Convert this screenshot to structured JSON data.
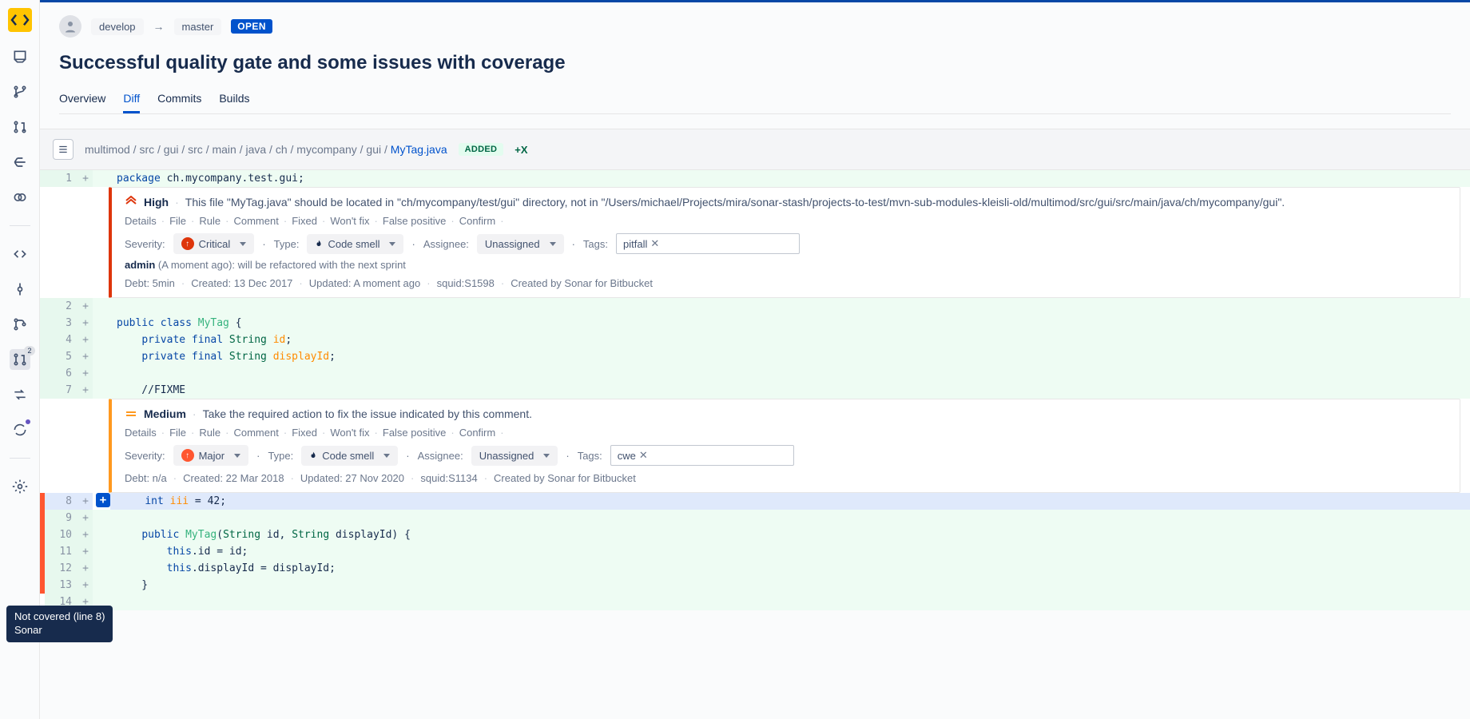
{
  "branch": {
    "from": "develop",
    "to": "master",
    "status": "OPEN"
  },
  "title": "Successful quality gate and some issues with coverage",
  "tabs": [
    "Overview",
    "Diff",
    "Commits",
    "Builds"
  ],
  "active_tab": "Diff",
  "file": {
    "path_prefix": "multimod / src / gui / src / main / java / ch / mycompany / gui / ",
    "filename": "MyTag.java",
    "badge": "ADDED",
    "plus": "+X"
  },
  "lines": {
    "l1": {
      "n": "1",
      "code_html": "<span class='kw'>package</span> ch.mycompany.test.gui;"
    },
    "l2": {
      "n": "2",
      "code_html": ""
    },
    "l3": {
      "n": "3",
      "code_html": "<span class='kw'>public class</span> <span class='cls'>MyTag</span> {"
    },
    "l4": {
      "n": "4",
      "code_html": "    <span class='kw'>private final</span> <span class='typ'>String</span> <span class='id-col'>id</span>;"
    },
    "l5": {
      "n": "5",
      "code_html": "    <span class='kw'>private final</span> <span class='typ'>String</span> <span class='id-col'>displayId</span>;"
    },
    "l6": {
      "n": "6",
      "code_html": ""
    },
    "l7": {
      "n": "7",
      "code_html": "    //FIXME"
    },
    "l8": {
      "n": "8",
      "code_html": "    <span class='kw'>int</span> <span class='id-col'>iii</span> = 42;"
    },
    "l9": {
      "n": "9",
      "code_html": ""
    },
    "l10": {
      "n": "10",
      "code_html": "    <span class='kw'>public</span> <span class='cls'>MyTag</span>(<span class='typ'>String</span> id, <span class='typ'>String</span> displayId) {"
    },
    "l11": {
      "n": "11",
      "code_html": "        <span class='kw'>this</span>.id = id;"
    },
    "l12": {
      "n": "12",
      "code_html": "        <span class='kw'>this</span>.displayId = displayId;"
    },
    "l13": {
      "n": "13",
      "code_html": "    }"
    },
    "l14": {
      "n": "14",
      "code_html": ""
    }
  },
  "issue1": {
    "severity_label": "High",
    "message": "This file \"MyTag.java\" should be located in \"ch/mycompany/test/gui\" directory, not in \"/Users/michael/Projects/mira/sonar-stash/projects-to-test/mvn-sub-modules-kleisli-old/multimod/src/gui/src/main/java/ch/mycompany/gui\".",
    "actions": [
      "Details",
      "File",
      "Rule",
      "Comment",
      "Fixed",
      "Won't fix",
      "False positive",
      "Confirm"
    ],
    "severity_label2": "Severity:",
    "severity_dd": "Critical",
    "type_label": "Type:",
    "type_dd": "Code smell",
    "assignee_label": "Assignee:",
    "assignee_dd": "Unassigned",
    "tags_label": "Tags:",
    "tag": "pitfall",
    "comment_who": "admin",
    "comment_when": "(A moment ago):",
    "comment_text": "will be refactored with the next sprint",
    "meta": [
      "Debt: 5min",
      "Created: 13 Dec 2017",
      "Updated: A moment ago",
      "squid:S1598",
      "Created by Sonar for Bitbucket"
    ]
  },
  "issue2": {
    "severity_label": "Medium",
    "message": "Take the required action to fix the issue indicated by this comment.",
    "actions": [
      "Details",
      "File",
      "Rule",
      "Comment",
      "Fixed",
      "Won't fix",
      "False positive",
      "Confirm"
    ],
    "severity_label2": "Severity:",
    "severity_dd": "Major",
    "type_label": "Type:",
    "type_dd": "Code smell",
    "assignee_label": "Assignee:",
    "assignee_dd": "Unassigned",
    "tags_label": "Tags:",
    "tag": "cwe",
    "meta": [
      "Debt: n/a",
      "Created: 22 Mar 2018",
      "Updated: 27 Nov 2020",
      "squid:S1134",
      "Created by Sonar for Bitbucket"
    ]
  },
  "tooltip": {
    "line1": "Not covered (line 8)",
    "line2": "Sonar"
  },
  "sidebar_badge": "2"
}
